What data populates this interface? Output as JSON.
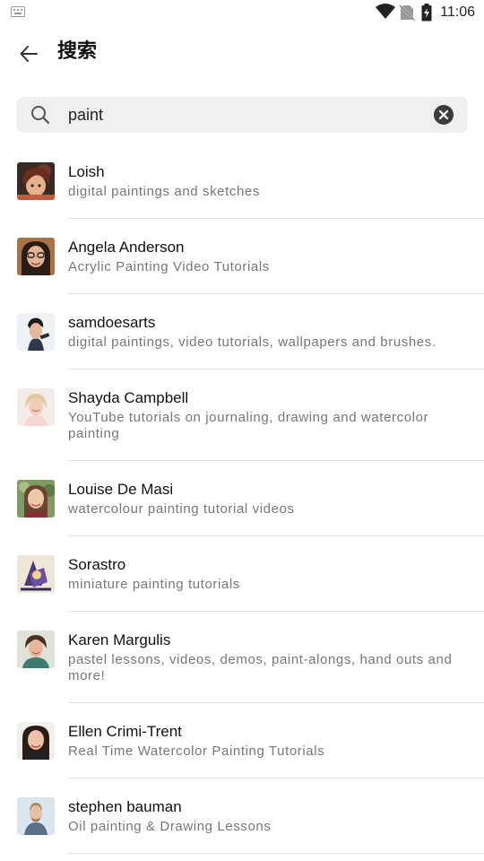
{
  "status_bar": {
    "time": "11:06",
    "icons": [
      "keyboard-icon",
      "wifi-icon",
      "no-sim-icon",
      "battery-charging-icon"
    ]
  },
  "header": {
    "title": "搜索",
    "back_icon": "arrow-left-icon"
  },
  "search": {
    "value": "paint",
    "search_icon": "search-icon",
    "clear_icon": "close-circle-icon"
  },
  "results": [
    {
      "name": "Loish",
      "description": "digital paintings and sketches"
    },
    {
      "name": "Angela Anderson",
      "description": "Acrylic Painting Video Tutorials"
    },
    {
      "name": "samdoesarts",
      "description": "digital paintings, video tutorials, wallpapers and brushes."
    },
    {
      "name": "Shayda Campbell",
      "description": "YouTube tutorials on journaling, drawing and watercolor painting"
    },
    {
      "name": "Louise De Masi",
      "description": "watercolour painting tutorial videos"
    },
    {
      "name": "Sorastro",
      "description": "miniature painting tutorials"
    },
    {
      "name": "Karen Margulis",
      "description": "pastel lessons, videos, demos, paint-alongs, hand outs and more!"
    },
    {
      "name": "Ellen Crimi-Trent",
      "description": "Real Time Watercolor Painting Tutorials"
    },
    {
      "name": "stephen bauman",
      "description": "Oil painting & Drawing Lessons"
    }
  ],
  "colors": {
    "search_bg": "#efefef",
    "divider": "#e2e2e2",
    "secondary_text": "#777777"
  }
}
